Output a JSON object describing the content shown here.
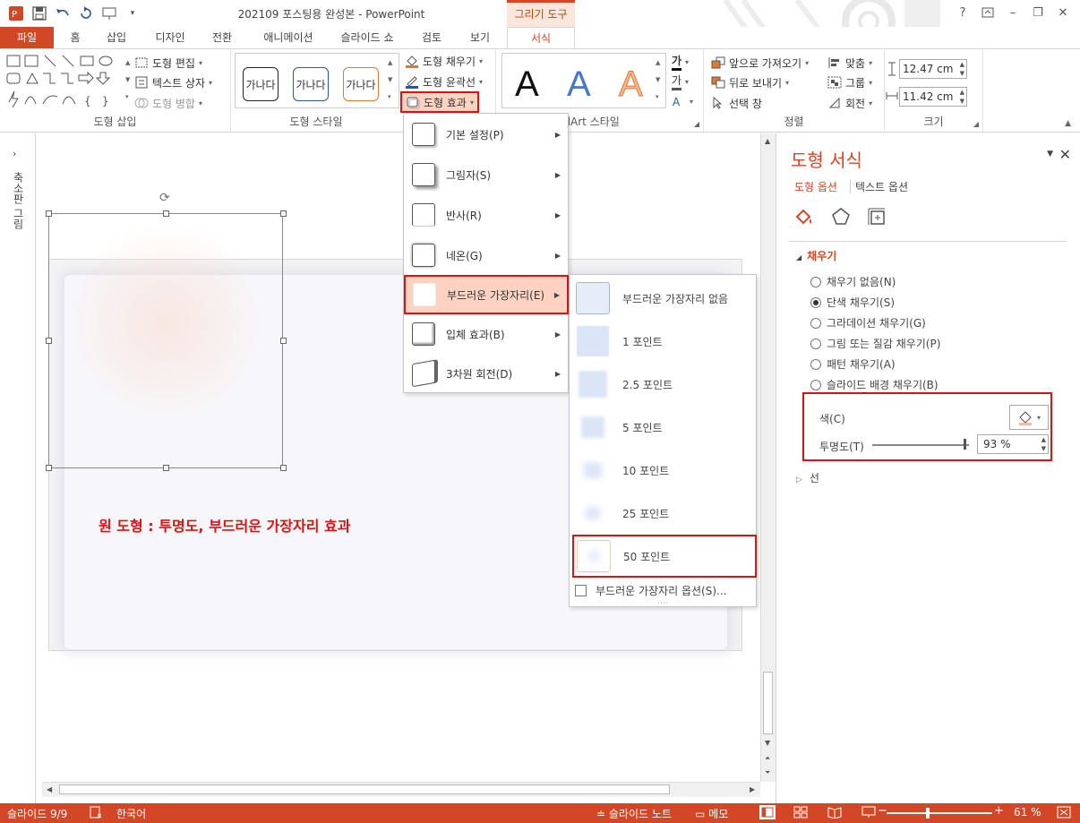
{
  "window": {
    "title": "202109 포스팅용 완성본 - PowerPoint",
    "contextual_tab": "그리기 도구",
    "help": "?",
    "minimize": "–",
    "restore": "❐",
    "close": "✕"
  },
  "tabs": [
    "파일",
    "홈",
    "삽입",
    "디자인",
    "전환",
    "애니메이션",
    "슬라이드 쇼",
    "검토",
    "보기",
    "서식"
  ],
  "ribbon": {
    "insert_shapes": {
      "label": "도형 삽입",
      "edit_shape": "도형 편집",
      "text_box": "텍스트 상자",
      "merge_shapes": "도형 병합"
    },
    "shape_styles": {
      "label": "도형 스타일",
      "thumb_text": "가나다",
      "shape_fill": "도형 채우기",
      "shape_outline": "도형 윤곽선",
      "shape_effects": "도형 효과"
    },
    "wordart": {
      "label": "WordArt 스타일",
      "letter": "A",
      "text_fill_glyph": "가",
      "text_outline_glyph": "가"
    },
    "arrange": {
      "label": "정렬",
      "bring_forward": "앞으로 가져오기",
      "send_backward": "뒤로 보내기",
      "selection_pane": "선택 창",
      "align": "맞춤",
      "group": "그룹",
      "rotate": "회전"
    },
    "size": {
      "label": "크기",
      "height": "12.47 cm",
      "width": "11.42 cm"
    }
  },
  "left_pane": {
    "label": "축소판 그림"
  },
  "canvas": {
    "annotation": "원 도형 : 투명도, 부드러운 가장자리 효과"
  },
  "effects_menu": {
    "items": [
      {
        "label": "기본 설정(P)"
      },
      {
        "label": "그림자(S)"
      },
      {
        "label": "반사(R)"
      },
      {
        "label": "네온(G)"
      },
      {
        "label": "부드러운 가장자리(E)"
      },
      {
        "label": "입체 효과(B)"
      },
      {
        "label": "3차원 회전(D)"
      }
    ],
    "active_index": 4
  },
  "soft_edges_submenu": {
    "items": [
      {
        "label": "부드러운 가장자리 없음"
      },
      {
        "label": "1 포인트"
      },
      {
        "label": "2.5 포인트"
      },
      {
        "label": "5 포인트"
      },
      {
        "label": "10 포인트"
      },
      {
        "label": "25 포인트"
      },
      {
        "label": "50 포인트"
      }
    ],
    "selected_index": 6,
    "options": "부드러운 가장자리 옵션(S)...",
    "grip": "····"
  },
  "format_pane": {
    "title": "도형 서식",
    "tab_shape": "도형 옵션",
    "tab_text": "텍스트 옵션",
    "fill_header": "채우기",
    "fill_options": [
      {
        "label": "채우기 없음(N)",
        "selected": false
      },
      {
        "label": "단색 채우기(S)",
        "selected": true
      },
      {
        "label": "그라데이션 채우기(G)",
        "selected": false
      },
      {
        "label": "그림 또는 질감 채우기(P)",
        "selected": false
      },
      {
        "label": "패턴 채우기(A)",
        "selected": false
      },
      {
        "label": "슬라이드 배경 채우기(B)",
        "selected": false
      }
    ],
    "color_label": "색(C)",
    "transparency_label": "투명도(T)",
    "transparency_value": "93 %",
    "transparency": 0.93,
    "line_header": "선"
  },
  "statusbar": {
    "slide": "슬라이드 9/9",
    "language": "한국어",
    "notes": "슬라이드 노트",
    "comments": "메모",
    "zoom": "61 %",
    "zoom_minus": "−",
    "zoom_plus": "+"
  },
  "colors": {
    "accent": "#d24726",
    "highlight": "#e01010",
    "status_bar": "#d24726"
  }
}
